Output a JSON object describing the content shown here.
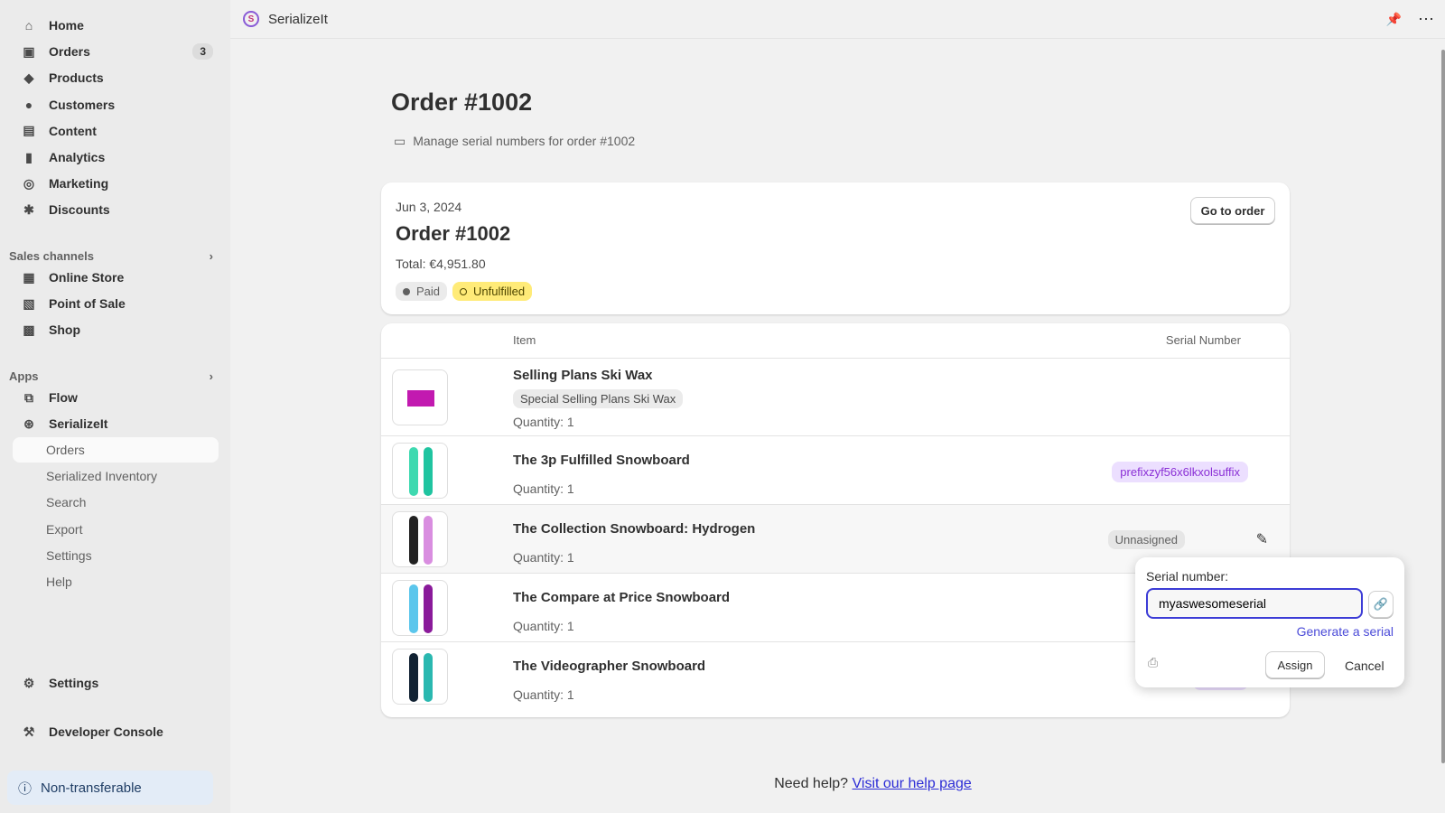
{
  "sidebar": {
    "main": [
      {
        "label": "Home",
        "icon": "home-icon",
        "g": "⌂"
      },
      {
        "label": "Orders",
        "icon": "inbox-icon",
        "g": "▣",
        "count": "3"
      },
      {
        "label": "Products",
        "icon": "tag-icon",
        "g": "◆"
      },
      {
        "label": "Customers",
        "icon": "person-icon",
        "g": "●"
      },
      {
        "label": "Content",
        "icon": "content-icon",
        "g": "▤"
      },
      {
        "label": "Analytics",
        "icon": "bar-chart-icon",
        "g": "▮"
      },
      {
        "label": "Marketing",
        "icon": "target-icon",
        "g": "◎"
      },
      {
        "label": "Discounts",
        "icon": "discount-icon",
        "g": "✱"
      }
    ],
    "sales_channels": "Sales channels",
    "channels": [
      {
        "label": "Online Store",
        "icon": "store-icon",
        "g": "▦"
      },
      {
        "label": "Point of Sale",
        "icon": "pos-icon",
        "g": "▧"
      },
      {
        "label": "Shop",
        "icon": "shop-icon",
        "g": "▩"
      }
    ],
    "apps": "Apps",
    "app_items": [
      {
        "label": "Flow",
        "icon": "flow-icon",
        "g": "⧉"
      },
      {
        "label": "SerializeIt",
        "icon": "serializeit-icon",
        "g": "⊛"
      }
    ],
    "sub_items": [
      "Orders",
      "Serialized Inventory",
      "Search",
      "Export",
      "Settings",
      "Help"
    ],
    "settings": "Settings",
    "dev_console": "Developer Console",
    "non_transferable": "Non-transferable"
  },
  "topbar": {
    "app_name": "SerializeIt"
  },
  "page": {
    "title": "Order #1002",
    "subtitle": "Manage serial numbers for order #1002"
  },
  "order": {
    "date": "Jun 3, 2024",
    "title": "Order #1002",
    "total": "Total: €4,951.80",
    "paid": "Paid",
    "fulfillment": "Unfulfilled",
    "go_to_order": "Go to order"
  },
  "table": {
    "col_item": "Item",
    "col_serial": "Serial Number",
    "rows": [
      {
        "name": "Selling Plans Ski Wax",
        "variant": "Special Selling Plans Ski Wax",
        "quantity": "Quantity: 1"
      },
      {
        "name": "The 3p Fulfilled Snowboard",
        "quantity": "Quantity: 1",
        "serial": "prefixzyf56x6lkxolsuffix"
      },
      {
        "name": "The Collection Snowboard: Hydrogen",
        "quantity": "Quantity: 1",
        "status": "Unnasigned"
      },
      {
        "name": "The Compare at Price Snowboard",
        "quantity": "Quantity: 1"
      },
      {
        "name": "The Videographer Snowboard",
        "quantity": "Quantity: 1",
        "serial": "prefixm"
      }
    ]
  },
  "popover": {
    "label": "Serial number:",
    "value": "myaswesomeserial",
    "generate": "Generate a serial",
    "assign": "Assign",
    "cancel": "Cancel"
  },
  "footer": {
    "text": "Need help?",
    "link": "Visit our help page"
  },
  "colors": {
    "accent": "#4338ca",
    "serial_bg": "#ecdfff",
    "serial_text": "#8a2fd6",
    "unfulfilled": "#ffeb78"
  }
}
